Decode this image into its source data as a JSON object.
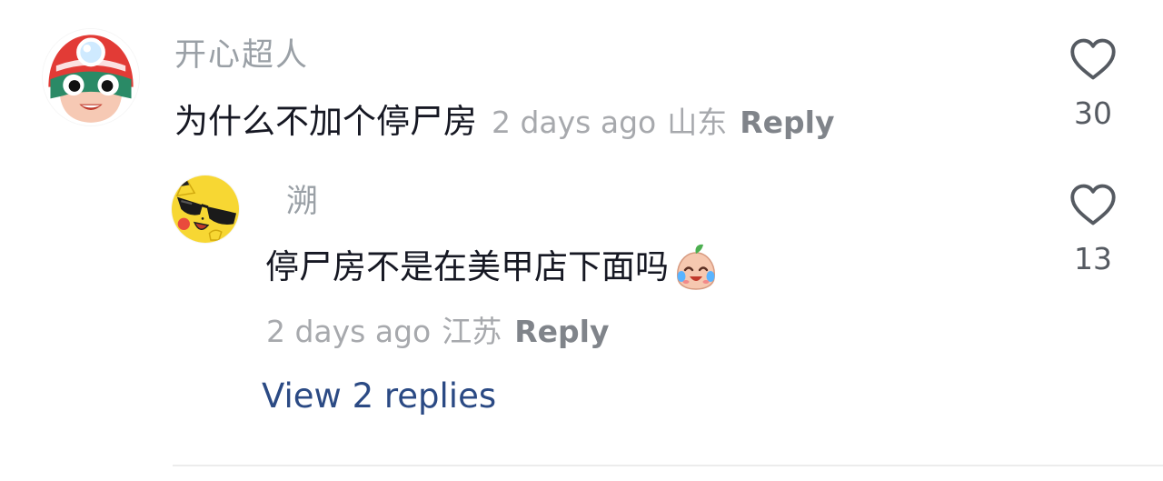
{
  "comment": {
    "username": "开心超人",
    "text": "为什么不加个停尸房",
    "time": "2 days ago",
    "region": "山东",
    "reply_label": "Reply",
    "like_count": "30",
    "avatar_icon": "superhero-avatar-icon"
  },
  "reply": {
    "username": "溯",
    "text": "停尸房不是在美甲店下面吗",
    "emoji_icon": "crying-laughing-emoji-icon",
    "time": "2 days ago",
    "region": "江苏",
    "reply_label": "Reply",
    "like_count": "13",
    "avatar_icon": "pikachu-sunglasses-avatar-icon"
  },
  "view_replies_label": "View 2 replies",
  "colors": {
    "username": "#9aa0a6",
    "body_text": "#161823",
    "meta": "#a7a9ad",
    "reply_button": "#80848a",
    "link": "#2b4a84",
    "like_count": "#555a61"
  }
}
